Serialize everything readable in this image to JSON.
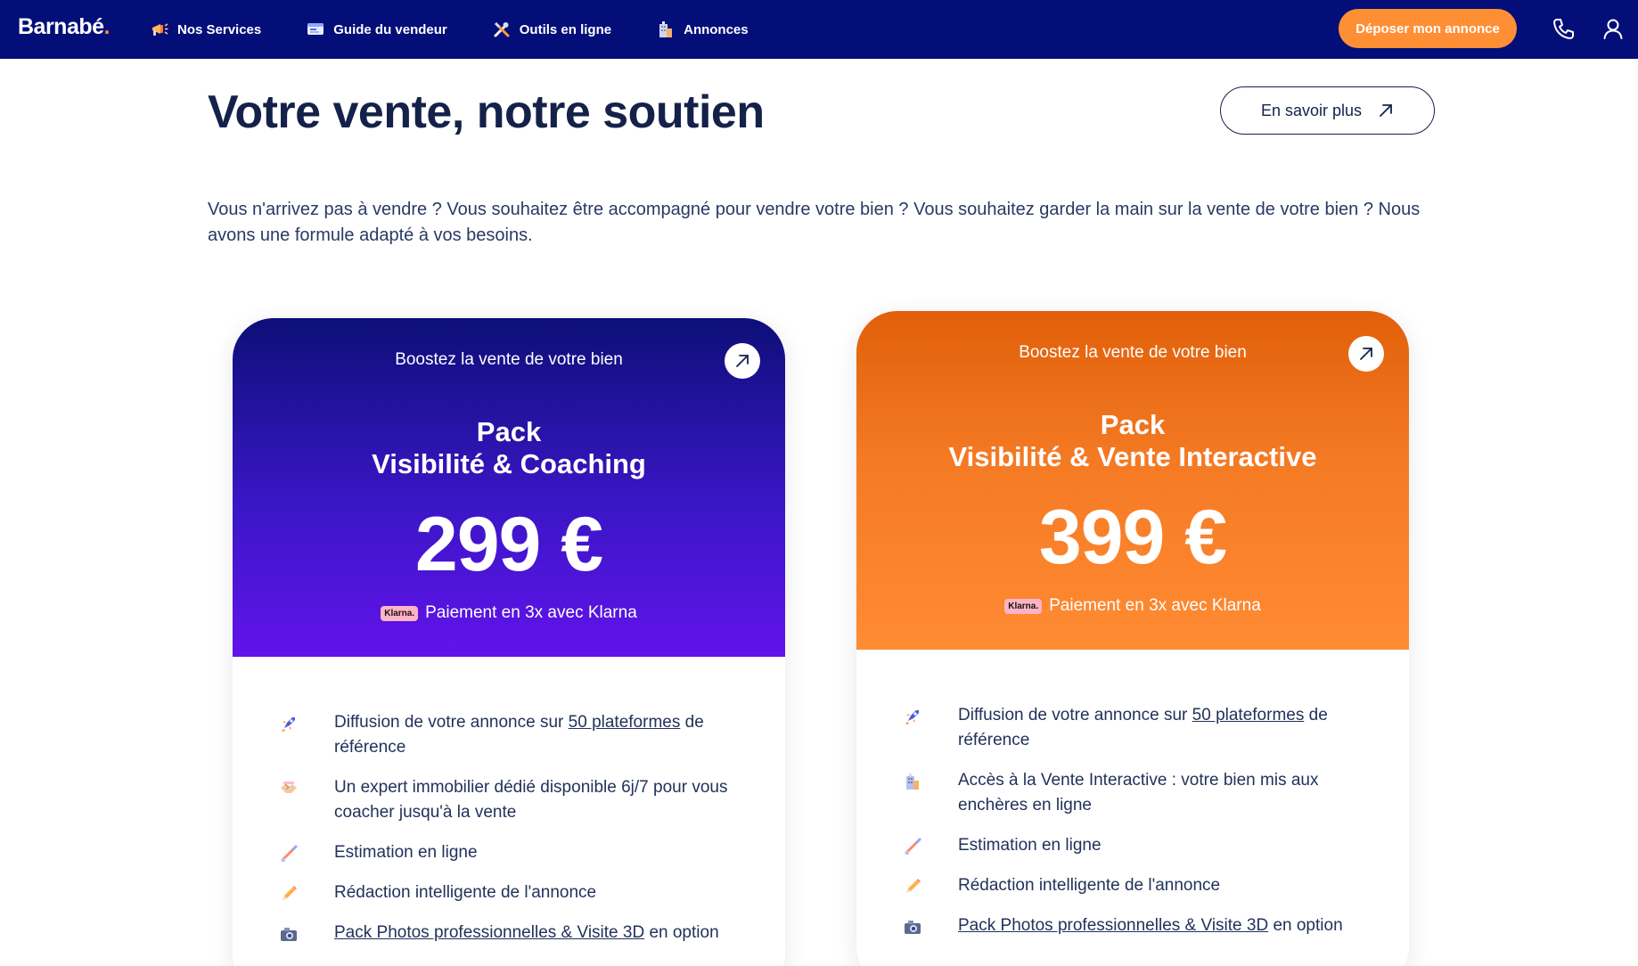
{
  "header": {
    "logo": "Barnabé",
    "logo_dot": ".",
    "nav": [
      {
        "label": "Nos Services",
        "icon": "megaphone-icon"
      },
      {
        "label": "Guide du vendeur",
        "icon": "guide-icon"
      },
      {
        "label": "Outils en ligne",
        "icon": "tools-icon"
      },
      {
        "label": "Annonces",
        "icon": "building-icon"
      }
    ],
    "cta_label": "Déposer mon annonce",
    "icons": [
      "phone-icon",
      "user-icon"
    ]
  },
  "section": {
    "title": "Votre vente, notre soutien",
    "more_label": "En savoir plus",
    "intro": "Vous n'arrivez pas à vendre ? Vous souhaitez être accompagné pour vendre votre bien ? Vous souhaitez garder la main sur la vente de votre bien ? Nous avons une formule adapté à vos besoins."
  },
  "cards": [
    {
      "tagline": "Boostez la vente de votre bien",
      "pack_line1": "Pack",
      "pack_line2": "Visibilité & Coaching",
      "price": "299 €",
      "klarna_badge": "Klarna.",
      "klarna_text": "Paiement en 3x avec Klarna",
      "features": [
        {
          "icon": "rocket-icon",
          "before": "Diffusion de votre annonce sur ",
          "link": "50 plateformes",
          "after": " de référence"
        },
        {
          "icon": "handshake-icon",
          "before": "Un expert immobilier dédié disponible 6j/7 pour vous coacher jusqu'à la vente",
          "link": "",
          "after": ""
        },
        {
          "icon": "estimate-icon",
          "before": "Estimation en ligne",
          "link": "",
          "after": ""
        },
        {
          "icon": "pencil-icon",
          "before": "Rédaction intelligente de l'annonce",
          "link": "",
          "after": ""
        },
        {
          "icon": "camera-icon",
          "before": "",
          "link": "Pack Photos professionnelles & Visite 3D",
          "after": " en option"
        }
      ]
    },
    {
      "tagline": "Boostez la vente de votre bien",
      "pack_line1": "Pack",
      "pack_line2": "Visibilité & Vente Interactive",
      "price": "399 €",
      "klarna_badge": "Klarna.",
      "klarna_text": "Paiement en 3x avec Klarna",
      "features": [
        {
          "icon": "rocket-icon",
          "before": "Diffusion de votre annonce sur ",
          "link": "50 plateformes",
          "after": " de référence"
        },
        {
          "icon": "building-icon",
          "before": "Accès à la Vente Interactive : votre bien mis aux enchères en ligne",
          "link": "",
          "after": ""
        },
        {
          "icon": "estimate-icon",
          "before": "Estimation en ligne",
          "link": "",
          "after": ""
        },
        {
          "icon": "pencil-icon",
          "before": "Rédaction intelligente de l'annonce",
          "link": "",
          "after": ""
        },
        {
          "icon": "camera-icon",
          "before": "",
          "link": "Pack Photos professionnelles & Visite 3D",
          "after": " en option"
        }
      ]
    }
  ],
  "colors": {
    "header_bg": "#040e78",
    "cta_bg": "#ff8f35",
    "blue_card_top": "#0d0f78",
    "blue_card_bottom": "#6213ea",
    "orange_card_top": "#e1600a",
    "orange_card_bottom": "#ff8b33"
  }
}
